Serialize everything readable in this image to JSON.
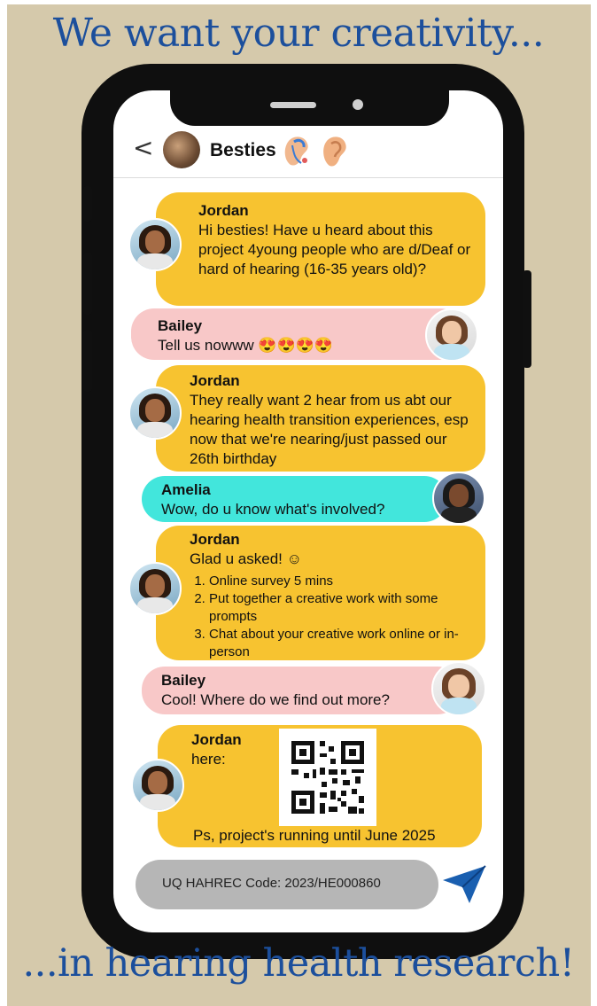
{
  "headline_top": "We want your creativity...",
  "headline_bottom": "...in hearing health research!",
  "header": {
    "back_glyph": "<",
    "group_name": "Besties"
  },
  "messages": [
    {
      "sender": "Jordan",
      "text": "Hi besties! Have u heard about this project 4young people who are d/Deaf or hard of hearing (16-35 years old)?"
    },
    {
      "sender": "Bailey",
      "text": "Tell us nowww 😍😍😍😍"
    },
    {
      "sender": "Jordan",
      "text": "They really want 2 hear from us abt our hearing health transition experiences, esp now that we're nearing/just passed our 26th birthday"
    },
    {
      "sender": "Amelia",
      "text": "Wow, do u know what's involved?"
    },
    {
      "sender": "Jordan",
      "text": "Glad u asked! ☺",
      "steps": [
        "Online survey 5 mins",
        "Put together a creative work with some prompts",
        "Chat about your creative work online or in-person"
      ]
    },
    {
      "sender": "Bailey",
      "text": "Cool! Where do we find out more?"
    },
    {
      "sender": "Jordan",
      "text": "here:",
      "footer": "Ps, project's running until June 2025"
    }
  ],
  "input": {
    "value": "UQ HAHREC Code: 2023/HE000860"
  },
  "colors": {
    "yellow": "#f7c330",
    "pink": "#f8c8c8",
    "teal": "#42e6dc",
    "headline": "#1c4f9c",
    "send": "#1a5fb0"
  }
}
